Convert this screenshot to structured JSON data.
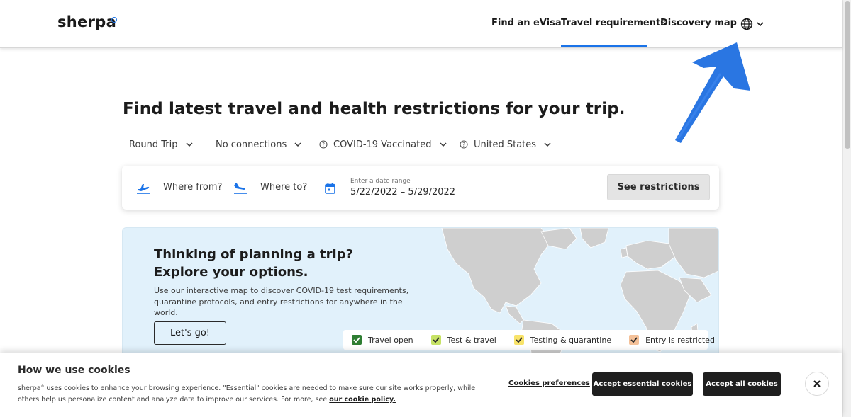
{
  "header": {
    "logo": "sherpa",
    "nav": [
      {
        "label": "Find an eVisa"
      },
      {
        "label": "Travel requirements",
        "active": true
      },
      {
        "label": "Discovery map"
      }
    ],
    "language_icon": "globe-icon"
  },
  "hero": {
    "headline": "Find latest travel and health restrictions for your trip."
  },
  "filters": {
    "trip_type": "Round Trip",
    "connections": "No connections",
    "vaccination": "COVID-19 Vaccinated",
    "passport": "United States"
  },
  "search": {
    "from_label": "Where from?",
    "to_label": "Where to?",
    "date_label": "Enter a date range",
    "date_value": "5/22/2022 – 5/29/2022",
    "submit_label": "See restrictions"
  },
  "promo": {
    "title_line1": "Thinking of planning a trip?",
    "title_line2": "Explore your options.",
    "description": "Use our interactive map to discover COVID-19 test requirements, quarantine protocols, and entry restrictions for anywhere in the world.",
    "button_label": "Let's go!",
    "legend": [
      {
        "label": "Travel open",
        "color": "#2e7d32"
      },
      {
        "label": "Test & travel",
        "color": "#c6e265"
      },
      {
        "label": "Testing & quarantine",
        "color": "#f8e36a"
      },
      {
        "label": "Entry is restricted",
        "color": "#f4c199"
      }
    ]
  },
  "cookies": {
    "title": "How we use cookies",
    "text": "sherpa° uses cookies to enhance your browsing experience. \"Essential\" cookies are needed to make sure our site works properly, while others help us personalize content and analyze data to improve our services. For more, see",
    "policy_link": "our cookie policy.",
    "preferences": "Cookies preferences",
    "accept_essential": "Accept essential cookies",
    "accept_all": "Accept all cookies"
  },
  "colors": {
    "accent": "#1a73e8",
    "annotation_arrow": "#1f6fe0",
    "promo_bg": "#e1f1fb",
    "dark_button": "#1f1f1f"
  }
}
